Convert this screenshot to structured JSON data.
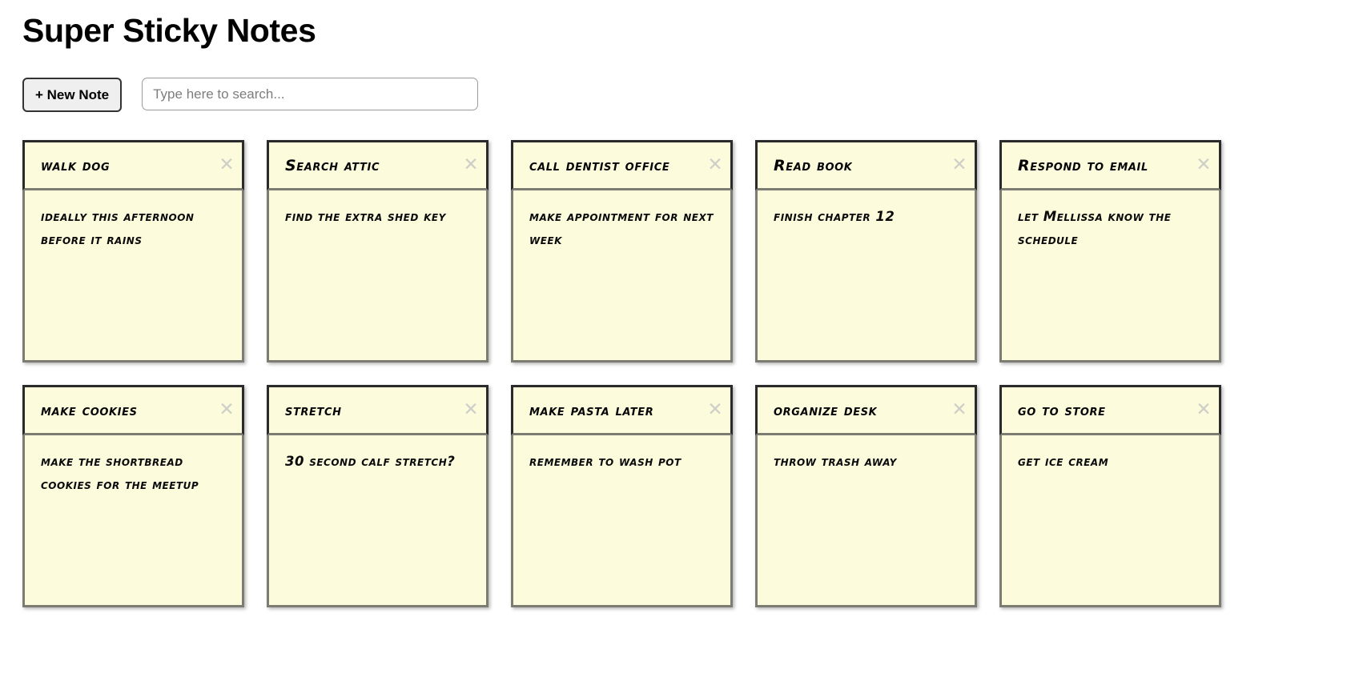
{
  "app": {
    "title": "Super Sticky Notes"
  },
  "toolbar": {
    "new_note_label": "+ New Note",
    "search_placeholder": "Type here to search...",
    "search_value": ""
  },
  "icons": {
    "close": "✕"
  },
  "colors": {
    "note_background": "#FCFBDC",
    "note_header_border": "#2a2a2a",
    "note_body_border": "#7c7c72",
    "close_icon": "#cfcfc9",
    "button_background": "#efefef",
    "page_background": "#ffffff"
  },
  "notes": [
    {
      "title": "walk dog",
      "body": "ideally this afternoon before it rains"
    },
    {
      "title": "Search attic",
      "body": "find the extra shed key"
    },
    {
      "title": "call dentist office",
      "body": "make appointment for next week"
    },
    {
      "title": "Read book",
      "body": "finish chapter 12"
    },
    {
      "title": "Respond to email",
      "body": "let Mellissa know the schedule"
    },
    {
      "title": "make cookies",
      "body": "make the shortbread cookies for the meetup"
    },
    {
      "title": "stretch",
      "body": "30 second calf stretch?"
    },
    {
      "title": "make pasta later",
      "body": "remember to wash pot"
    },
    {
      "title": "organize desk",
      "body": "throw trash away"
    },
    {
      "title": "go to store",
      "body": "get ice cream"
    }
  ]
}
